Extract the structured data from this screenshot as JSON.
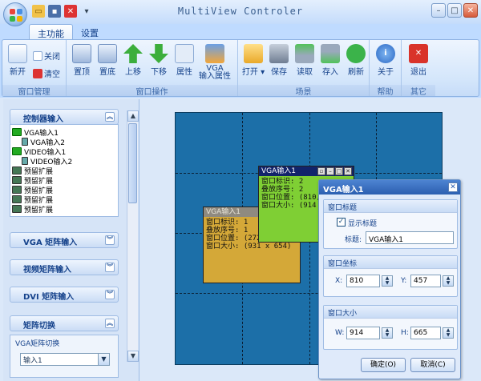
{
  "app": {
    "title": "MultiView Controler"
  },
  "tabs": [
    "主功能",
    "设置"
  ],
  "ribbon": {
    "groups": [
      "窗口管理",
      "窗口操作",
      "场景",
      "帮助",
      "其它"
    ],
    "win_mgmt": {
      "new": "新开",
      "close": "关闭",
      "clear": "清空"
    },
    "win_ops": {
      "top": "置顶",
      "bottom": "置底",
      "up": "上移",
      "down": "下移",
      "props": "属性",
      "vga_props_1": "VGA",
      "vga_props_2": "输入属性"
    },
    "scene": {
      "open": "打开",
      "save": "保存",
      "read": "读取",
      "store": "存入",
      "refresh": "刷新"
    },
    "help": {
      "about": "关于"
    },
    "other": {
      "exit": "退出"
    }
  },
  "left": {
    "sections": [
      "控制器输入",
      "VGA 矩阵输入",
      "视频矩阵输入",
      "DVI 矩阵输入",
      "矩阵切换"
    ],
    "tree": [
      "VGA输入1",
      "VGA输入2",
      "VIDEO输入1",
      "VIDEO输入2",
      "预留扩展",
      "预留扩展",
      "预留扩展",
      "预留扩展",
      "预留扩展"
    ],
    "vga_switch": {
      "title": "VGA矩阵切换",
      "selected": "输入1"
    }
  },
  "wall": {
    "win_green": {
      "title": "VGA输入1",
      "lines": [
        "窗口标识: 2",
        "叠放序号: 2",
        "窗口位置: (810,",
        "窗口大小: (914"
      ]
    },
    "win_yellow": {
      "title": "VGA输入1",
      "lines": [
        "窗口标识: 1",
        "叠放序号: 1",
        "窗口位置: (272,",
        "窗口大小: (931 x 654)"
      ]
    }
  },
  "dialog": {
    "title": "VGA输入1",
    "sec_title": "窗口标题",
    "show_title": "显示标题",
    "title_label": "标题:",
    "title_value": "VGA输入1",
    "sec_pos": "窗口坐标",
    "x_label": "X:",
    "x_value": "810",
    "y_label": "Y:",
    "y_value": "457",
    "sec_size": "窗口大小",
    "w_label": "W:",
    "w_value": "914",
    "h_label": "H:",
    "h_value": "665",
    "ok": "确定(O)",
    "cancel": "取消(C)"
  }
}
